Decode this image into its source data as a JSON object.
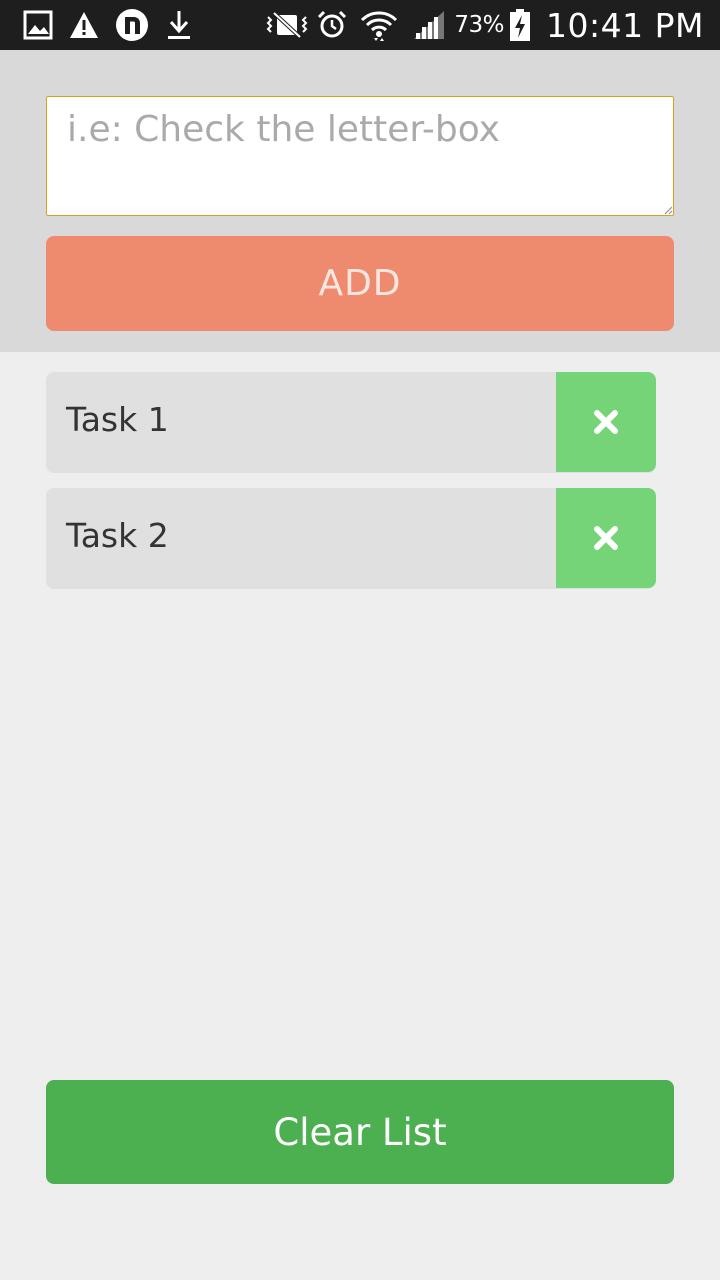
{
  "status_bar": {
    "left_icons": [
      "gallery-icon",
      "warning-icon",
      "n-app-icon",
      "download-icon"
    ],
    "right_icons": [
      "vibrate-mute-icon",
      "alarm-icon",
      "wifi-icon",
      "signal-icon",
      "battery-charging-icon"
    ],
    "battery_percent": "73%",
    "time": "10:41 PM"
  },
  "input": {
    "value": "",
    "placeholder": "i.e: Check the letter-box",
    "border_color": "#d9a020"
  },
  "add_button": {
    "label": "ADD",
    "color": "#ee8b6f"
  },
  "tasks": [
    {
      "label": "Task 1",
      "remove_icon": "close-icon"
    },
    {
      "label": "Task 2",
      "remove_icon": "close-icon"
    }
  ],
  "remove_button_color": "#75d378",
  "clear_button": {
    "label": "Clear List",
    "color": "#4caf50"
  }
}
